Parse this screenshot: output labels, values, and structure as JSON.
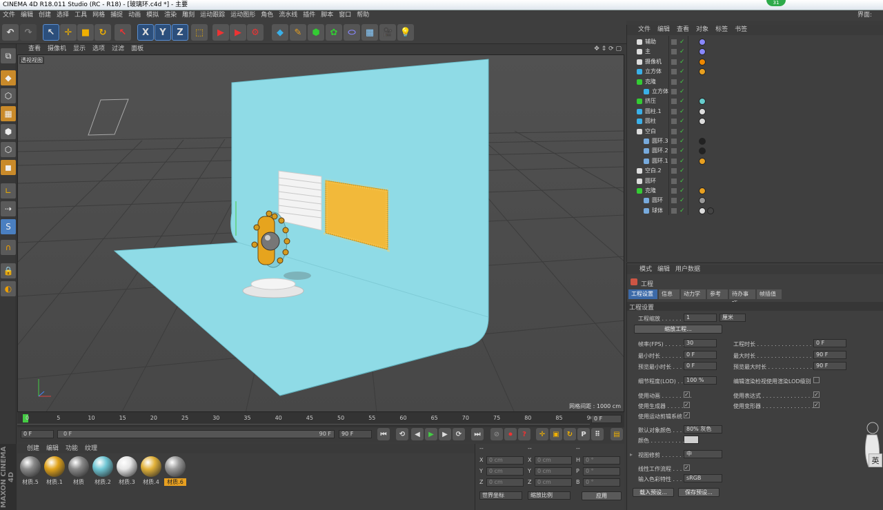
{
  "title": "CINEMA 4D R18.011 Studio (RC - R18) - [玻璃环.c4d *] - 主要",
  "interface_label": "界面:",
  "badge": "31",
  "menu": [
    "文件",
    "编辑",
    "创建",
    "选择",
    "工具",
    "网格",
    "捕捉",
    "动画",
    "模拟",
    "渲染",
    "雕刻",
    "运动跟踪",
    "运动图形",
    "角色",
    "流水线",
    "插件",
    "脚本",
    "窗口",
    "帮助"
  ],
  "viewport_menu": [
    "查看",
    "摄像机",
    "显示",
    "选项",
    "过滤",
    "面板"
  ],
  "viewport_label": "透视视图",
  "grid_info": "网格间距 : 1000 cm",
  "timeline_ticks": [
    "0",
    "5",
    "10",
    "15",
    "20",
    "25",
    "30",
    "35",
    "40",
    "45",
    "50",
    "55",
    "60",
    "65",
    "70",
    "75",
    "80",
    "85",
    "90"
  ],
  "current_frame": "0 F",
  "transport": {
    "start": "0 F",
    "range_start": "0 F",
    "range_end": "90 F",
    "end": "90 F"
  },
  "material_menu": [
    "创建",
    "编辑",
    "功能",
    "纹理"
  ],
  "materials": [
    {
      "name": "材质.5",
      "color": "#8a8a8a"
    },
    {
      "name": "材质.1",
      "color": "#e0a31c"
    },
    {
      "name": "材质",
      "color": "#888888"
    },
    {
      "name": "材质.2",
      "color": "#6fc6d4"
    },
    {
      "name": "材质.3",
      "color": "#e6e6e6"
    },
    {
      "name": "材质.4",
      "color": "#e2b23a"
    },
    {
      "name": "材质.6",
      "color": "#9a9a9a"
    }
  ],
  "coords": {
    "header": [
      "--",
      "--",
      "--"
    ],
    "rows": [
      {
        "a": "X",
        "av": "0 cm",
        "b": "X",
        "bv": "0 cm",
        "c": "H",
        "cv": "0 °"
      },
      {
        "a": "Y",
        "av": "0 cm",
        "b": "Y",
        "bv": "0 cm",
        "c": "P",
        "cv": "0 °"
      },
      {
        "a": "Z",
        "av": "0 cm",
        "b": "Z",
        "bv": "0 cm",
        "c": "B",
        "cv": "0 °"
      }
    ],
    "world": "世界坐标",
    "scale": "缩放比例",
    "apply": "应用"
  },
  "object_menu": [
    "文件",
    "编辑",
    "查看",
    "对象",
    "标签",
    "书签"
  ],
  "objects": [
    {
      "name": "辅助",
      "indent": 0
    },
    {
      "name": "主",
      "indent": 0
    },
    {
      "name": "摄像机",
      "indent": 0
    },
    {
      "name": "立方体",
      "indent": 0
    },
    {
      "name": "克隆",
      "indent": 0
    },
    {
      "name": "立方体",
      "indent": 1
    },
    {
      "name": "挤压",
      "indent": 0
    },
    {
      "name": "圆柱.1",
      "indent": 0
    },
    {
      "name": "圆柱",
      "indent": 0
    },
    {
      "name": "空白",
      "indent": 0
    },
    {
      "name": "圆环.3",
      "indent": 1
    },
    {
      "name": "圆环.2",
      "indent": 1
    },
    {
      "name": "圆环.1",
      "indent": 1
    },
    {
      "name": "空白.2",
      "indent": 0
    },
    {
      "name": "圆环",
      "indent": 0
    },
    {
      "name": "克隆",
      "indent": 0
    },
    {
      "name": "圆环",
      "indent": 1
    },
    {
      "name": "球体",
      "indent": 1
    }
  ],
  "attr_menu": [
    "模式",
    "编辑",
    "用户数据"
  ],
  "attr_title": "工程",
  "attr_tabs": [
    "工程设置",
    "信息",
    "动力学",
    "参考",
    "待办事项",
    "帧插值"
  ],
  "section": "工程设置",
  "project": {
    "scale_label": "工程缩放 . . . . . . . . .",
    "scale_value": "1",
    "scale_unit": "厘米",
    "scale_btn": "缩放工程...",
    "fps_label": "帧率(FPS) . . . . . . .",
    "fps": "30",
    "duration_label": "工程时长 . . . . . . . . . . . . . . . . .",
    "duration": "0 F",
    "min_label": "最小时长 . . . . . . . .",
    "min": "0 F",
    "max_label": "最大时长 . . . . . . . . . . . . . . . . .",
    "max": "90 F",
    "pmin_label": "预览最小时长 . . . .",
    "pmin": "0 F",
    "pmax_label": "预览最大时长 . . . . . . . . . . . . .",
    "pmax": "90 F",
    "lod_label": "细节程度(LOD) . .",
    "lod": "100 %",
    "lod_render_label": "编辑渲染检视使用渲染LOD级别",
    "anim_label": "使用动画 . . . . . . . . .",
    "expr_label": "使用表达式 . . . . . . . . . . . . . . .",
    "gen_label": "使用生成器 . . . . . . .",
    "deform_label": "使用变形器 . . . . . . . . . . . . . . .",
    "motion_label": "使用运动剪辑系统",
    "objcolor_label": "默认对象颜色 . . .",
    "objcolor": "80% 灰色",
    "color_label": "颜色 . . . . . . . . . . .",
    "viewclip_label": "视图修剪 . . . . . . . .",
    "viewclip": "中",
    "linear_label": "线性工作流程 . . . . .",
    "inputcolor_label": "输入色彩特性 . . . .",
    "inputcolor": "sRGB",
    "load_btn": "载入预设...",
    "save_btn": "保存预设..."
  },
  "ime_label": "英"
}
